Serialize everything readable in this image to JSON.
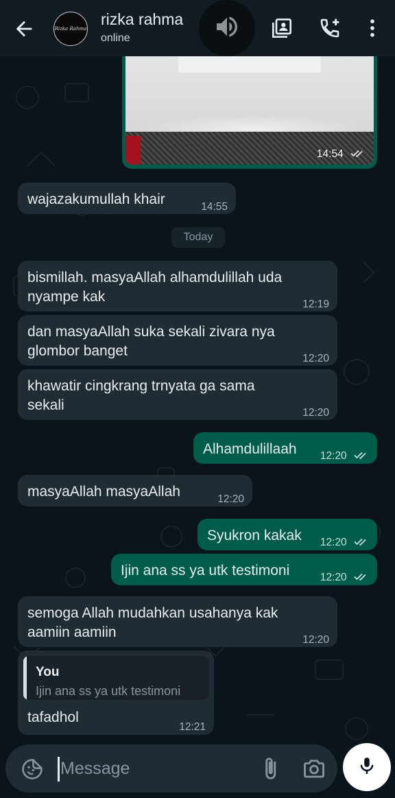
{
  "header": {
    "name": "rizka rahma",
    "status": "online",
    "avatar_text": "Rizka Rahma"
  },
  "image_message": {
    "time": "14:54"
  },
  "messages": [
    {
      "dir": "in",
      "text": "wajazakumullah khair",
      "time": "14:55"
    },
    {
      "dir": "in",
      "text": "bismillah. masyaAllah alhamdulillah uda\nnyampe kak",
      "time": "12:19"
    },
    {
      "dir": "in",
      "text": "dan masyaAllah suka sekali zivara nya\nglombor banget",
      "time": "12:20"
    },
    {
      "dir": "in",
      "text": "khawatir cingkrang trnyata ga sama\nsekali",
      "time": "12:20"
    },
    {
      "dir": "out",
      "text": "Alhamdulillaah",
      "time": "12:20"
    },
    {
      "dir": "in",
      "text": "masyaAllah masyaAllah",
      "time": "12:20"
    },
    {
      "dir": "out",
      "text": "Syukron kakak",
      "time": "12:20"
    },
    {
      "dir": "out",
      "text": "Ijin ana ss ya utk testimoni",
      "time": "12:20"
    },
    {
      "dir": "in",
      "text": "semoga Allah mudahkan usahanya kak\naamiin aamiin",
      "time": "12:20"
    },
    {
      "dir": "in",
      "text": "tafadhol",
      "time": "12:21",
      "reply_author": "You",
      "reply_text": "Ijin ana ss ya utk testimoni"
    }
  ],
  "date_divider": "Today",
  "composer": {
    "placeholder": "Message"
  },
  "colors": {
    "background": "#0b141a",
    "header": "#111b21",
    "incoming": "#202c33",
    "outgoing": "#005c4b",
    "tick": "#c6e3da"
  },
  "icons": {
    "back": "arrow-left-icon",
    "speaker": "speaker-icon",
    "contact_card": "contact-card-icon",
    "add_call": "add-call-icon",
    "menu": "more-vertical-icon",
    "emoji": "sticker-emoji-icon",
    "attach": "paperclip-icon",
    "camera": "camera-icon",
    "mic": "microphone-icon"
  }
}
